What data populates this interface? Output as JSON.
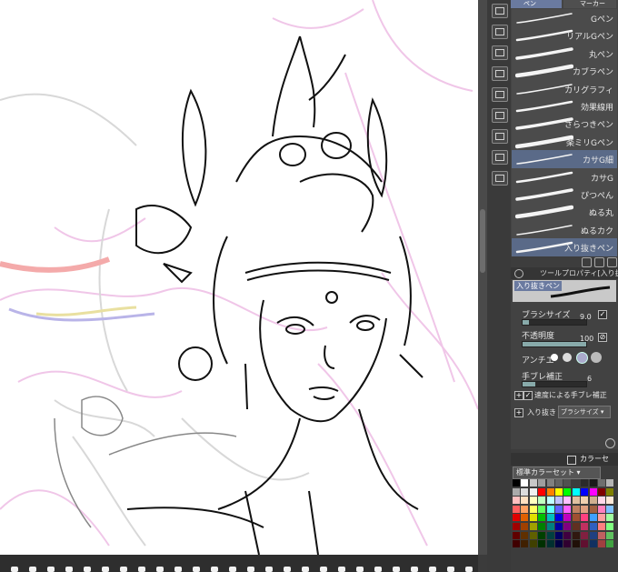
{
  "app": {
    "accent": "#5a6a88"
  },
  "brushes": {
    "top_tabs": [
      "ペン",
      "マーカー"
    ],
    "items": [
      {
        "label": "Gペン",
        "selected": false
      },
      {
        "label": "リアルGペン",
        "selected": false
      },
      {
        "label": "丸ペン",
        "selected": false
      },
      {
        "label": "カブラペン",
        "selected": false
      },
      {
        "label": "カリグラフィ",
        "selected": false
      },
      {
        "label": "効果線用",
        "selected": false
      },
      {
        "label": "さらつきペン",
        "selected": false
      },
      {
        "label": "楽ミリGペン",
        "selected": false
      },
      {
        "label": "カサG細",
        "selected": true
      },
      {
        "label": "カサG",
        "selected": false
      },
      {
        "label": "ぴつぺん",
        "selected": false
      },
      {
        "label": "ぬる丸",
        "selected": false
      },
      {
        "label": "ぬるカク",
        "selected": false
      },
      {
        "label": "入り抜きペン",
        "selected": true
      }
    ]
  },
  "tool_property": {
    "header": "ツールプロパティ[入り抜き",
    "tool_name": "入り抜きペン",
    "brush_size_label": "ブラシサイズ",
    "brush_size_value": "9.0",
    "brush_size_level": 0.1,
    "opacity_label": "不透明度",
    "opacity_value": "100",
    "opacity_level": 1.0,
    "anti_alias_label": "アンチエ",
    "stabilization_label": "手ブレ補正",
    "stabilization_value": "6",
    "stabilization_level": 0.2,
    "speed_stabilize_label": "速度による手ブレ補正",
    "taper_label": "入り抜き",
    "taper_select": "ブラシサイズ"
  },
  "color": {
    "panel_title": "カラーセ",
    "set_name": "標準カラーセット",
    "rows": [
      [
        "#000000",
        "#ffffff",
        "#c8c8c8",
        "#9e9e9e",
        "#808080",
        "#646464",
        "#505050",
        "#3c3c3c",
        "#2a2a2a",
        "#1a1a1a",
        "#6e6e6e",
        "#b4b4b4"
      ],
      [
        "#aaaaaa",
        "#dcdcdc",
        "#f0f0f0",
        "#ff0000",
        "#ff8000",
        "#ffff00",
        "#00ff00",
        "#00ffff",
        "#0000ff",
        "#ff00ff",
        "#800000",
        "#808000"
      ],
      [
        "#ffc0c0",
        "#ffe0c0",
        "#ffffc0",
        "#c0ffc0",
        "#c0ffff",
        "#c0c0ff",
        "#ffc0ff",
        "#e0c0a0",
        "#f0d0b0",
        "#d0b090",
        "#ffd8e8",
        "#ffe8d8"
      ],
      [
        "#ff6060",
        "#ffa060",
        "#ffff60",
        "#60ff60",
        "#60ffff",
        "#6060ff",
        "#ff60ff",
        "#c08060",
        "#e0a080",
        "#a06040",
        "#ff80c0",
        "#80c0ff"
      ],
      [
        "#e00000",
        "#e06000",
        "#e0e000",
        "#00c000",
        "#00c0c0",
        "#0000e0",
        "#c000c0",
        "#a05030",
        "#ff4080",
        "#40a0ff",
        "#ffa0a0",
        "#a0ffa0"
      ],
      [
        "#a00000",
        "#a04000",
        "#a0a000",
        "#008000",
        "#008080",
        "#0000a0",
        "#800080",
        "#603020",
        "#c03060",
        "#3060c0",
        "#ff8080",
        "#80ff80"
      ],
      [
        "#600000",
        "#603000",
        "#606000",
        "#004000",
        "#004040",
        "#000060",
        "#400040",
        "#301810",
        "#802040",
        "#204080",
        "#c06060",
        "#60c060"
      ],
      [
        "#400000",
        "#402000",
        "#404000",
        "#003000",
        "#003030",
        "#000040",
        "#300030",
        "#201008",
        "#601030",
        "#103060",
        "#a04040",
        "#40a040"
      ]
    ]
  }
}
